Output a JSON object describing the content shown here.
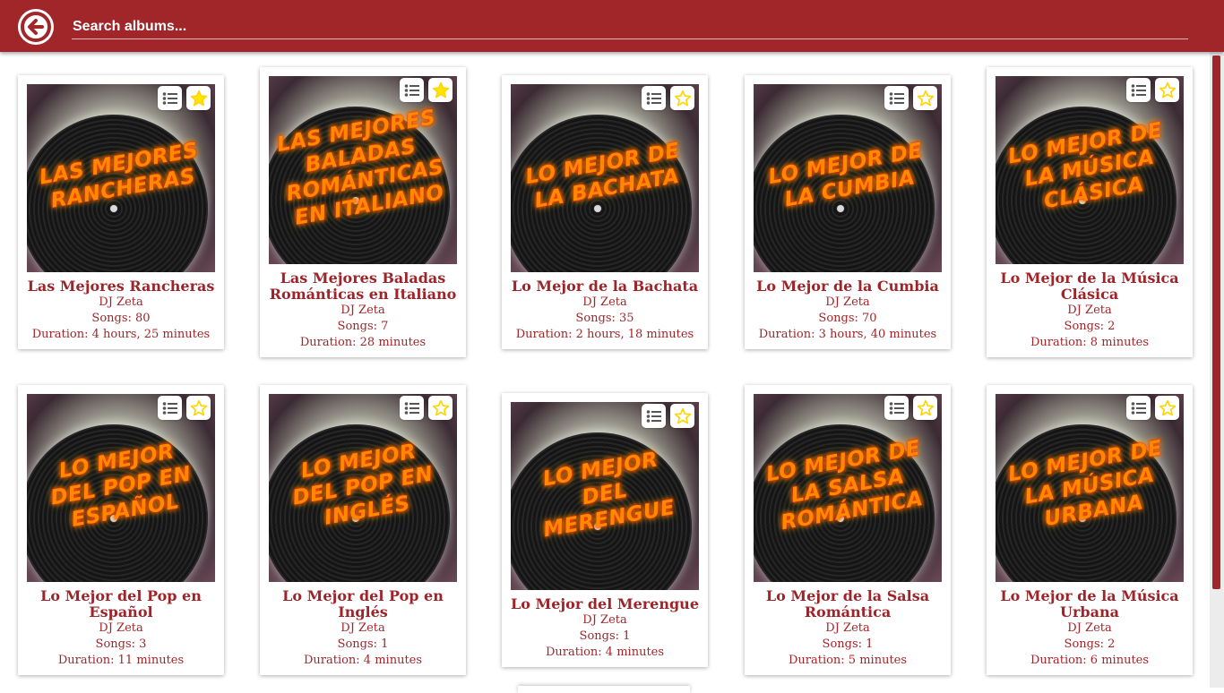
{
  "header": {
    "search_placeholder": "Search albums..."
  },
  "colors": {
    "brand": "#a1262a",
    "text": "#9e2429",
    "fav_star": "#ffe600"
  },
  "albums": [
    {
      "title": "Las Mejores Rancheras",
      "cover_text": "Las Mejores Rancheras",
      "artist": "DJ Zeta",
      "songs": "Songs: 80",
      "duration": "Duration: 4 hours, 25 minutes",
      "favorite": true
    },
    {
      "title": "Las Mejores Baladas Románticas en Italiano",
      "cover_text": "Las Mejores Baladas Románticas en Italiano",
      "artist": "DJ Zeta",
      "songs": "Songs: 7",
      "duration": "Duration: 28 minutes",
      "favorite": true
    },
    {
      "title": "Lo Mejor de la Bachata",
      "cover_text": "Lo Mejor de la Bachata",
      "artist": "DJ Zeta",
      "songs": "Songs: 35",
      "duration": "Duration: 2 hours, 18 minutes",
      "favorite": false
    },
    {
      "title": "Lo Mejor de la Cumbia",
      "cover_text": "Lo Mejor de la Cumbia",
      "artist": "DJ Zeta",
      "songs": "Songs: 70",
      "duration": "Duration: 3 hours, 40 minutes",
      "favorite": false
    },
    {
      "title": "Lo Mejor de la Música Clásica",
      "cover_text": "Lo Mejor de la Música Clásica",
      "artist": "DJ Zeta",
      "songs": "Songs: 2",
      "duration": "Duration: 8 minutes",
      "favorite": false
    },
    {
      "title": "Lo Mejor del Pop en Español",
      "cover_text": "Lo Mejor del Pop en Español",
      "artist": "DJ Zeta",
      "songs": "Songs: 3",
      "duration": "Duration: 11 minutes",
      "favorite": false
    },
    {
      "title": "Lo Mejor del Pop en Inglés",
      "cover_text": "Lo Mejor del Pop en Inglés",
      "artist": "DJ Zeta",
      "songs": "Songs: 1",
      "duration": "Duration: 4 minutes",
      "favorite": false
    },
    {
      "title": "Lo Mejor del Merengue",
      "cover_text": "Lo Mejor del Merengue",
      "artist": "DJ Zeta",
      "songs": "Songs: 1",
      "duration": "Duration: 4 minutes",
      "favorite": false
    },
    {
      "title": "Lo Mejor de la Salsa Romántica",
      "cover_text": "Lo Mejor de la Salsa Romántica",
      "artist": "DJ Zeta",
      "songs": "Songs: 1",
      "duration": "Duration: 5 minutes",
      "favorite": false
    },
    {
      "title": "Lo Mejor de la Música Urbana",
      "cover_text": "Lo Mejor de la Música Urbana",
      "artist": "DJ Zeta",
      "songs": "Songs: 2",
      "duration": "Duration: 6 minutes",
      "favorite": false
    }
  ]
}
